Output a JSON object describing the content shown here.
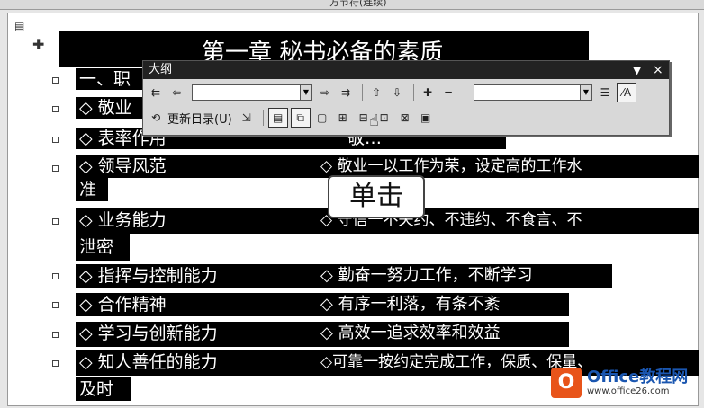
{
  "window": {
    "title": "方节符(连续)"
  },
  "document": {
    "chapter_title": "第一章  秘书必备的素质",
    "lines": [
      {
        "left": "一、职",
        "right": ""
      },
      {
        "left": "◇ 敬业",
        "right": ""
      },
      {
        "left": "◇ 表率作用",
        "right": "敬…"
      },
      {
        "left": "◇ 领导风范",
        "right": "◇ 敬业一以工作为荣，设定高的工作水"
      },
      {
        "left": "准",
        "right": ""
      },
      {
        "left": "◇ 业务能力",
        "right": "◇ 守信一不失约、不违约、不食言、不"
      },
      {
        "left": "泄密",
        "right": ""
      },
      {
        "left": "◇ 指挥与控制能力",
        "right": "◇ 勤奋一努力工作，不断学习"
      },
      {
        "left": "◇ 合作精神",
        "right": "◇ 有序一利落，有条不紊"
      },
      {
        "left": "◇ 学习与创新能力",
        "right": "◇ 高效一追求效率和效益"
      },
      {
        "left": "◇ 知人善任的能力",
        "right": "◇可靠一按约定完成工作，保质、保量、"
      },
      {
        "left": "及时",
        "right": ""
      }
    ]
  },
  "outline_toolbar": {
    "title": "大纲",
    "update_toc_label": "更新目录",
    "update_toc_shortcut": "(U)",
    "close_glyph": "×",
    "menu_glyph": "▼"
  },
  "callout": {
    "text": "单击"
  },
  "watermark": {
    "logo_letter": "O",
    "name": "Office教程网",
    "url": "www.office26.com"
  }
}
